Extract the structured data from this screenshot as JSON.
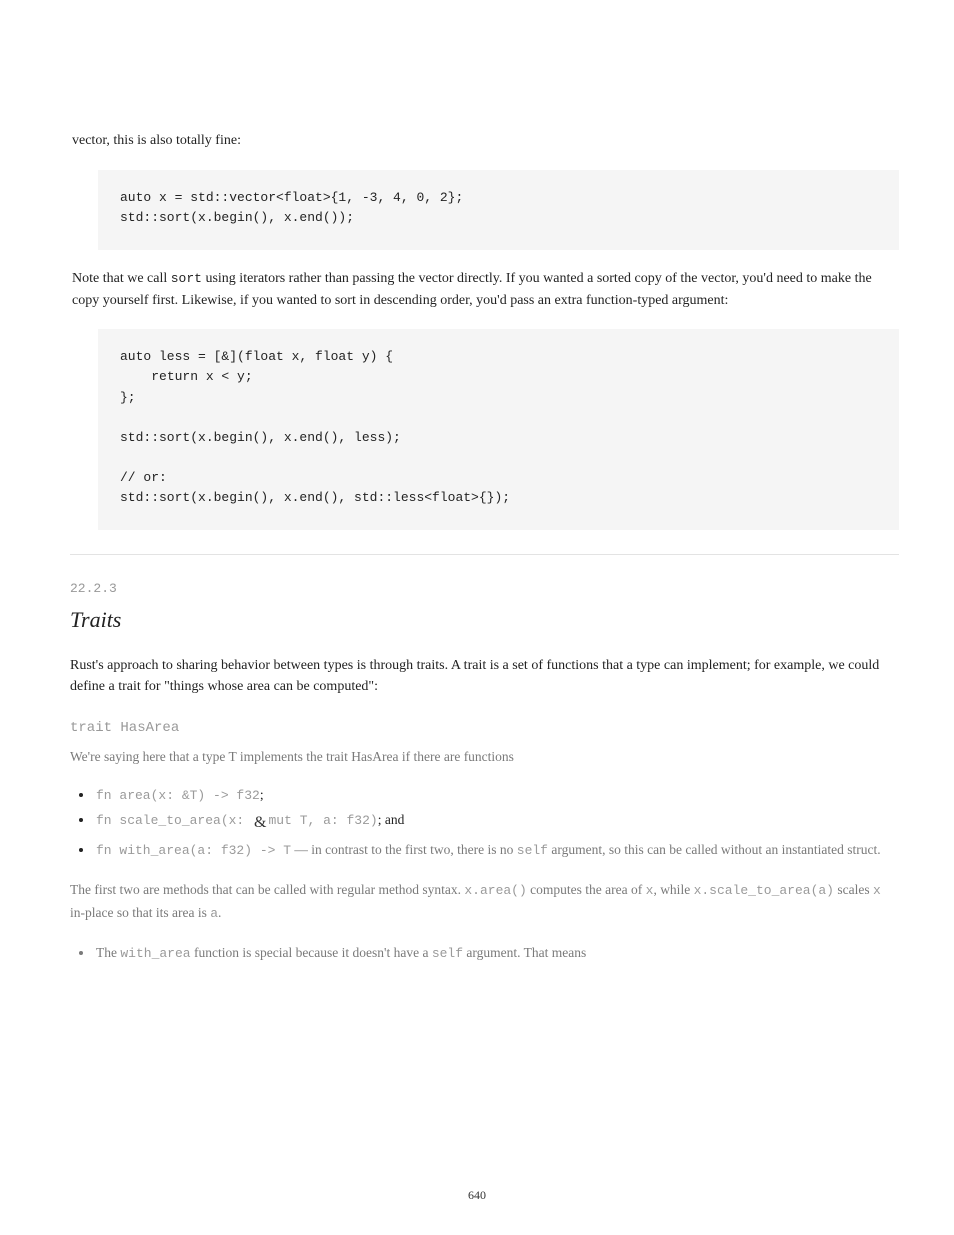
{
  "intro": "vector, this is also totally fine:",
  "code1": "auto x = std::vector<float>{1, -3, 4, 0, 2};\nstd::sort(x.begin(), x.end());",
  "between": {
    "pre": "Note that we call ",
    "code": "sort",
    "post": " using iterators rather than passing the vector directly. If you wanted a sorted copy of the vector, you'd need to make the copy yourself first. Likewise, if you wanted to sort in descending order, you'd pass an extra function-typed argument:"
  },
  "code2": "auto less = [&](float x, float y) {\n    return x < y;\n};\n\nstd::sort(x.begin(), x.end(), less);\n\n// or:\nstd::sort(x.begin(), x.end(), std::less<float>{});",
  "section": {
    "number": "22.2.3",
    "title": "Traits"
  },
  "para1": "Rust's approach to sharing behavior between types is through traits. A trait is a set of functions that a type can implement; for example, we could define a trait for \"things whose area can be computed\":",
  "subheading": "trait HasArea",
  "explain_lead": "We're saying here that a type T implements the trait HasArea if there are functions",
  "bullets": [
    {
      "text_pre": "",
      "code": "fn area(x: &T) -> f32",
      "text_post": ";"
    },
    {
      "text_pre": "",
      "code": "fn scale_to_area(x: ",
      "code_amp_img": true,
      "code_after": "mut T, a: f32)",
      "text_post": "; and"
    },
    {
      "text_pre": "",
      "code": "fn with_area(a: f32) -> T",
      "text_post": " — in contrast to the first two, there is no ",
      "code2": "self",
      "text_post2": " argument, so this can be called without an instantiated struct."
    }
  ],
  "explain_para": {
    "pre": "The first two are methods that can be called with regular method syntax. ",
    "code1": "x.area()",
    "mid1": " computes the area of ",
    "code2": "x",
    "mid2": ", while ",
    "code3": "x.scale_to_area(a)",
    "mid3": " scales ",
    "code4": "x",
    "mid4": " in-place so that its area is ",
    "code5": "a",
    "post": "."
  },
  "explain_bullet": {
    "pre": "The ",
    "code1": "with_area",
    "mid": " function is special because it doesn't have a ",
    "code2": "self",
    "post": " argument. That means"
  },
  "page_number": "640"
}
